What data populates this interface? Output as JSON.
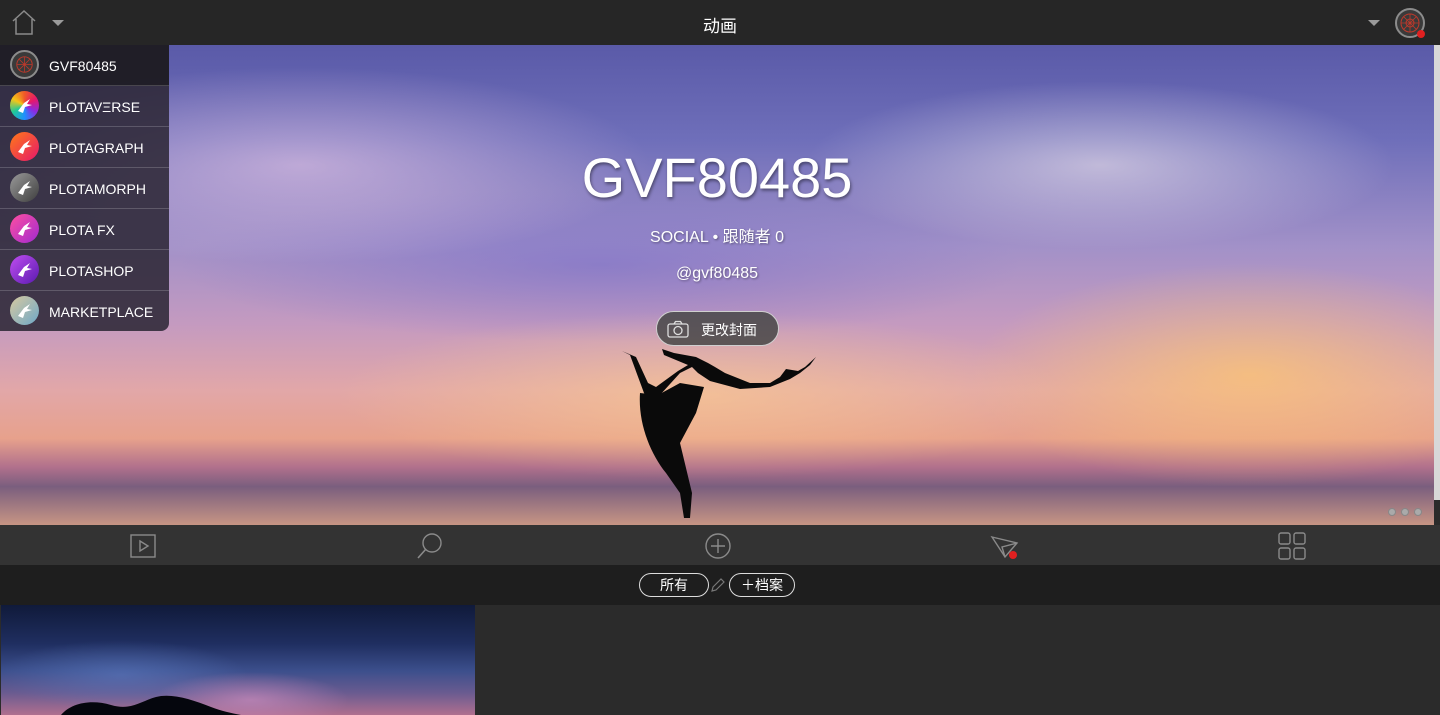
{
  "topbar": {
    "title": "动画",
    "home_icon": "home-icon"
  },
  "app_menu": {
    "items": [
      {
        "label": "GVF80485",
        "icon": "profile-mandala-icon",
        "color": "#3a3a3a"
      },
      {
        "label": "PLOTAVΞRSE",
        "icon": "plotaverse-logo-icon",
        "color": "#e63d6b"
      },
      {
        "label": "PLOTAGRAPH",
        "icon": "plotagraph-logo-icon",
        "color": "#f04a3a"
      },
      {
        "label": "PLOTAMORPH",
        "icon": "plotamorph-logo-icon",
        "color": "#6e6e6e"
      },
      {
        "label": "PLOTA FX",
        "icon": "plotafx-logo-icon",
        "color": "#d03a8a"
      },
      {
        "label": "PLOTASHOP",
        "icon": "plotashop-logo-icon",
        "color": "#8a3ad0"
      },
      {
        "label": "MARKETPLACE",
        "icon": "marketplace-logo-icon",
        "color": "#8fb3c9"
      }
    ]
  },
  "hero": {
    "name": "GVF80485",
    "social": "SOCIAL • 跟随者 0",
    "handle": "@gvf80485",
    "cover_button": "更改封面"
  },
  "toolbar": {
    "items": [
      "play-icon",
      "search-icon",
      "add-icon",
      "send-icon",
      "grid-icon"
    ],
    "notification_color": "#e02020"
  },
  "filter": {
    "all": "所有",
    "add_folder": "＋档案"
  }
}
